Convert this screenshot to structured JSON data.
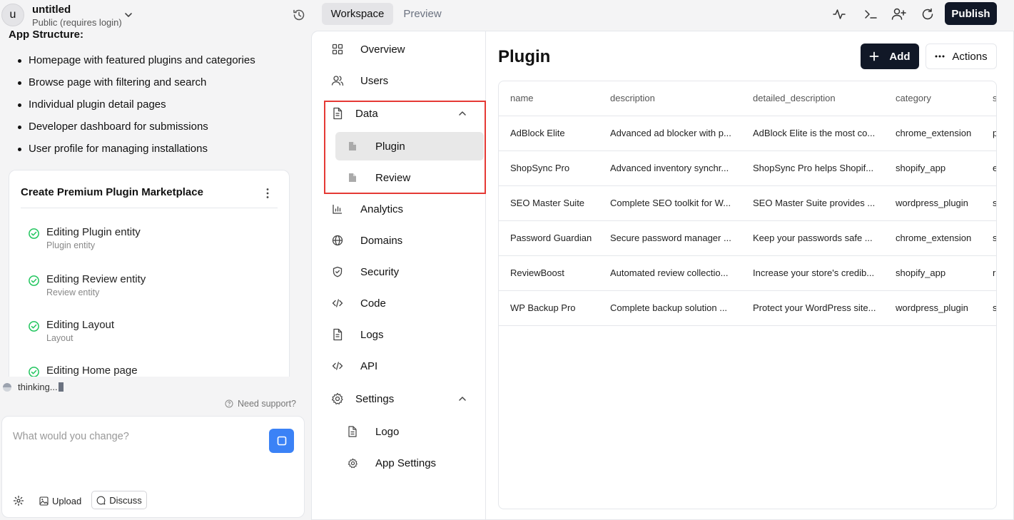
{
  "project": {
    "initial": "u",
    "name": "untitled",
    "visibility": "Public (requires login)"
  },
  "topbar": {
    "tabs": [
      {
        "label": "Workspace",
        "active": true
      },
      {
        "label": "Preview",
        "active": false
      }
    ],
    "icons": [
      "activity-icon",
      "terminal-icon",
      "user-plus-icon",
      "refresh-icon"
    ],
    "publish_label": "Publish"
  },
  "chat": {
    "section_title": "App Structure:",
    "bullets": [
      "Homepage with featured plugins and categories",
      "Browse page with filtering and search",
      "Individual plugin detail pages",
      "Developer dashboard for submissions",
      "User profile for managing installations"
    ],
    "plan": {
      "title": "Create Premium Plugin Marketplace",
      "tasks": [
        {
          "title": "Editing Plugin entity",
          "sub": "Plugin entity"
        },
        {
          "title": "Editing Review entity",
          "sub": "Review entity"
        },
        {
          "title": "Editing Layout",
          "sub": "Layout"
        },
        {
          "title": "Editing Home page",
          "sub": ""
        }
      ]
    },
    "status": "thinking...",
    "support_label": "Need support?",
    "composer": {
      "placeholder": "What would you change?",
      "value": "",
      "upload_label": "Upload",
      "discuss_label": "Discuss"
    }
  },
  "nav": {
    "items": [
      {
        "label": "Overview",
        "icon": "grid-icon"
      },
      {
        "label": "Users",
        "icon": "users-icon"
      },
      {
        "label": "Data",
        "icon": "file-icon",
        "expanded": true,
        "children": [
          {
            "label": "Plugin",
            "active": true
          },
          {
            "label": "Review",
            "active": false
          }
        ]
      },
      {
        "label": "Analytics",
        "icon": "bar-chart-icon"
      },
      {
        "label": "Domains",
        "icon": "globe-icon"
      },
      {
        "label": "Security",
        "icon": "shield-icon"
      },
      {
        "label": "Code",
        "icon": "code-icon"
      },
      {
        "label": "Logs",
        "icon": "file-text-icon"
      },
      {
        "label": "API",
        "icon": "code-icon"
      },
      {
        "label": "Settings",
        "icon": "gear-icon",
        "expanded": true,
        "children": [
          {
            "label": "Logo"
          },
          {
            "label": "App Settings"
          }
        ]
      }
    ]
  },
  "main": {
    "title": "Plugin",
    "add_label": "Add",
    "actions_label": "Actions",
    "columns": [
      "name",
      "description",
      "detailed_description",
      "category",
      "s"
    ],
    "rows": [
      [
        "AdBlock Elite",
        "Advanced ad blocker with p...",
        "AdBlock Elite is the most co...",
        "chrome_extension",
        "p"
      ],
      [
        "ShopSync Pro",
        "Advanced inventory synchr...",
        "ShopSync Pro helps Shopif...",
        "shopify_app",
        "e"
      ],
      [
        "SEO Master Suite",
        "Complete SEO toolkit for W...",
        "SEO Master Suite provides ...",
        "wordpress_plugin",
        "s"
      ],
      [
        "Password Guardian",
        "Secure password manager ...",
        "Keep your passwords safe ...",
        "chrome_extension",
        "s"
      ],
      [
        "ReviewBoost",
        "Automated review collectio...",
        "Increase your store's credib...",
        "shopify_app",
        "r"
      ],
      [
        "WP Backup Pro",
        "Complete backup solution ...",
        "Protect your WordPress site...",
        "wordpress_plugin",
        "s"
      ]
    ]
  },
  "colors": {
    "primary_dark": "#111827",
    "send_blue": "#3b82f6",
    "success_green": "#22c55e",
    "highlight_red": "#e53935"
  }
}
